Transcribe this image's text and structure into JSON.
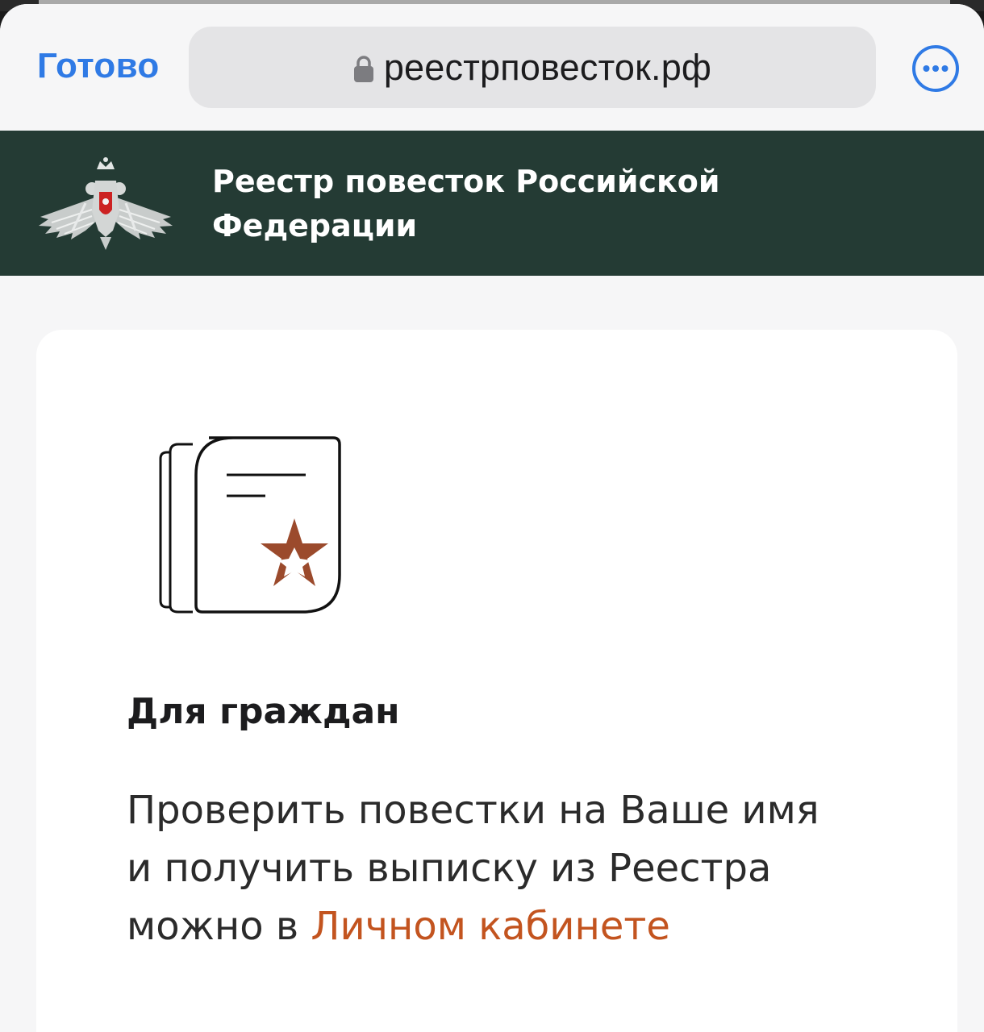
{
  "browser": {
    "done_label": "Готово",
    "url": "реестрповесток.рф",
    "accent_color": "#2f7ae5"
  },
  "site_header": {
    "title": "Реестр повесток Российской Федерации",
    "background_color": "#243b34",
    "emblem": "double-headed-eagle-emblem"
  },
  "card": {
    "icon": "document-with-star-icon",
    "title": "Для граждан",
    "text_before_link": "Проверить повестки на Ваше имя и получить выписку из Реестра можно в ",
    "link_text": "Личном кабинете",
    "link_color": "#c3541f"
  }
}
